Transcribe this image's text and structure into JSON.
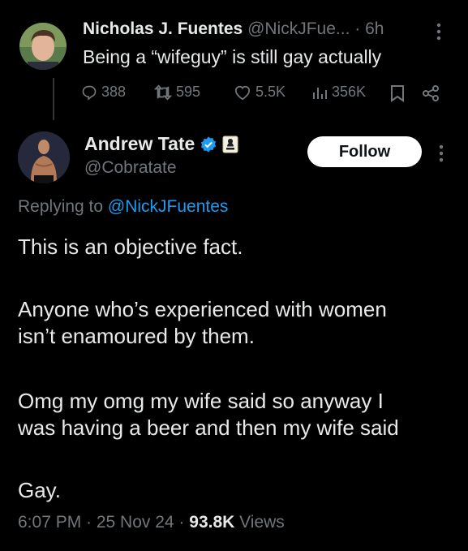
{
  "parent_tweet": {
    "display_name": "Nicholas J. Fuentes",
    "handle": "@NickJFue...",
    "time": "· 6h",
    "text": "Being a “wifeguy” is still gay actually",
    "stats": {
      "replies": "388",
      "retweets": "595",
      "likes": "5.5K",
      "views": "356K"
    }
  },
  "main_tweet": {
    "display_name": "Andrew Tate",
    "handle": "@Cobratate",
    "follow_label": "Follow",
    "replying_prefix": "Replying to",
    "replying_to": "@NickJFuentes",
    "paragraphs": [
      "This is an objective fact.",
      "Anyone who’s experienced with women\nisn’t enamoured by them.",
      "Omg my omg my wife said so anyway I\nwas having a beer and then my wife said",
      "Gay."
    ],
    "timestamp": "6:07 PM · 25 Nov 24 · ",
    "views_count": "93.8K",
    "views_label": "Views"
  },
  "colors": {
    "background": "#000000",
    "text": "#e7e9ea",
    "muted": "#71767b",
    "link": "#1d9bf0",
    "verified": "#1d9bf0"
  }
}
